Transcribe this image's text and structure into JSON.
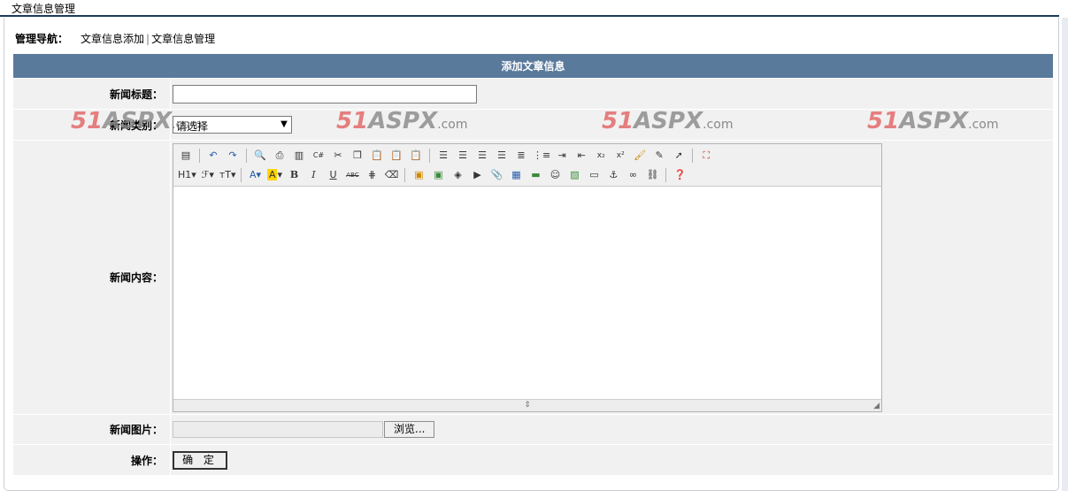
{
  "page_title": "文章信息管理",
  "nav": {
    "label": "管理导航：",
    "link_add": "文章信息添加",
    "separator": "|",
    "link_manage": "文章信息管理"
  },
  "form": {
    "header": "添加文章信息",
    "title_label": "新闻标题：",
    "title_value": "",
    "category_label": "新闻类别：",
    "category_selected": "请选择",
    "content_label": "新闻内容：",
    "image_label": "新闻图片：",
    "browse_label": "浏览...",
    "action_label": "操作：",
    "submit_label": "确 定"
  },
  "watermark": {
    "digits": "51",
    "brand": "ASPX",
    "suffix": ".com"
  },
  "editor": {
    "toolbar_row1": [
      "template-icon",
      "undo-icon",
      "redo-icon",
      "preview-icon",
      "print-icon",
      "page-icon",
      "code-icon",
      "cut-icon",
      "copy-icon",
      "paste-icon",
      "paste-text-icon",
      "paste-word-icon",
      "align-left-icon",
      "align-center-icon",
      "align-right-icon",
      "align-justify-icon",
      "ordered-list-icon",
      "unordered-list-icon",
      "indent-icon",
      "outdent-icon",
      "subscript-icon",
      "superscript-icon",
      "clear-format-icon",
      "select-all-icon",
      "pointer-icon",
      "fullscreen-icon"
    ],
    "toolbar_row2": {
      "heading": "H1",
      "font": "ℱ",
      "size": "тT",
      "bold": "B",
      "italic": "I",
      "underline": "U",
      "strike": "ABC"
    }
  }
}
